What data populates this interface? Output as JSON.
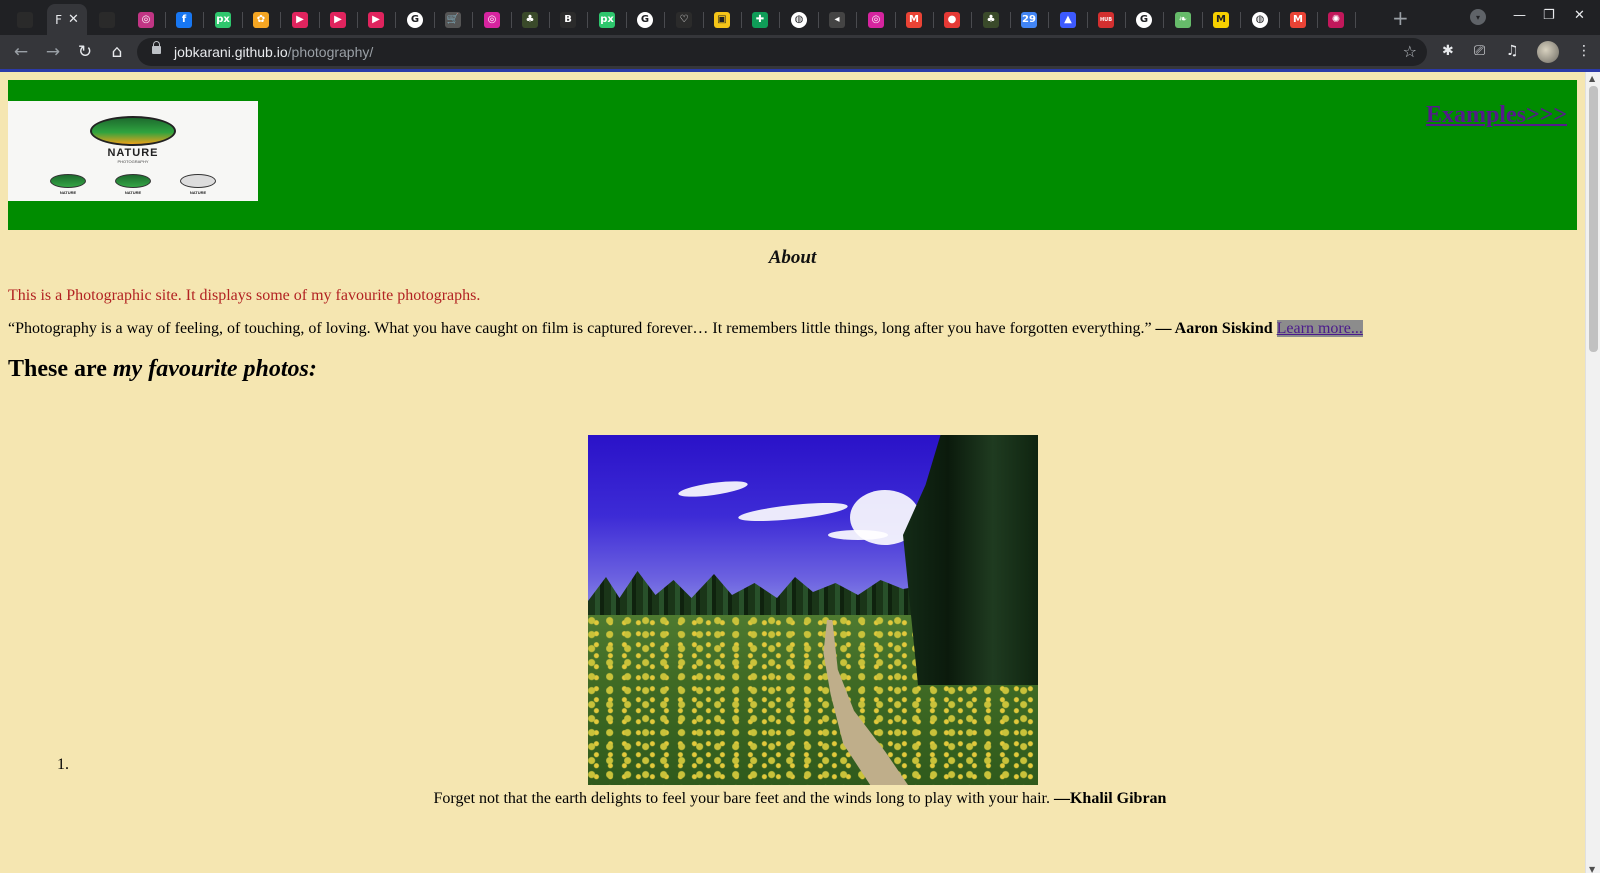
{
  "browser": {
    "active_tab_letter": "F",
    "active_tab_close": "✕",
    "new_tab": "+",
    "window_controls": {
      "minimize": "—",
      "restore": "❐",
      "close": "✕"
    },
    "nav": {
      "back": "←",
      "forward": "→",
      "reload": "↻",
      "home": "⌂"
    },
    "url_host": "jobkarani.github.io",
    "url_path": "/photography/",
    "bookmark_star": "☆",
    "toolbar_icons": {
      "extensions": "✱",
      "cast": "⎚",
      "media": "♫",
      "menu": "⋮"
    },
    "tab_favicons": [
      {
        "name": "instagram-icon",
        "color": "#c13584",
        "glyph": "◎"
      },
      {
        "name": "facebook-icon",
        "color": "#1877f2",
        "glyph": "f"
      },
      {
        "name": "pixabay-icon",
        "color": "#2ec66d",
        "glyph": "px"
      },
      {
        "name": "gear-icon",
        "color": "#f5a623",
        "glyph": "✿"
      },
      {
        "name": "youtube-icon",
        "color": "#e0245e",
        "glyph": "▶"
      },
      {
        "name": "youtube-icon",
        "color": "#e0245e",
        "glyph": "▶"
      },
      {
        "name": "youtube-icon",
        "color": "#e0245e",
        "glyph": "▶"
      },
      {
        "name": "google-icon",
        "color": "#ffffff",
        "glyph": "G"
      },
      {
        "name": "cart-icon",
        "color": "#555555",
        "glyph": "🛒"
      },
      {
        "name": "instagram-icon",
        "color": "#d6249f",
        "glyph": "◎"
      },
      {
        "name": "palm-icon",
        "color": "#3a4a2a",
        "glyph": "♣"
      },
      {
        "name": "bold-b-icon",
        "color": "#2b2b2b",
        "glyph": "B"
      },
      {
        "name": "pixabay-icon",
        "color": "#2ec66d",
        "glyph": "px"
      },
      {
        "name": "google-icon",
        "color": "#ffffff",
        "glyph": "G"
      },
      {
        "name": "heart-icon",
        "color": "#2b2b2b",
        "glyph": "♡"
      },
      {
        "name": "badge-icon",
        "color": "#f5c518",
        "glyph": "▣"
      },
      {
        "name": "sheets-icon",
        "color": "#0f9d58",
        "glyph": "✚"
      },
      {
        "name": "globe-icon",
        "color": "#ffffff",
        "glyph": "◍"
      },
      {
        "name": "speaker-icon",
        "color": "#444444",
        "glyph": "◂"
      },
      {
        "name": "instagram-icon",
        "color": "#d6249f",
        "glyph": "◎"
      },
      {
        "name": "gmail-icon",
        "color": "#ea4335",
        "glyph": "M"
      },
      {
        "name": "record-icon",
        "color": "#e53935",
        "glyph": "●"
      },
      {
        "name": "palm-icon",
        "color": "#3a4a2a",
        "glyph": "♣"
      },
      {
        "name": "calendar-icon",
        "color": "#4285f4",
        "glyph": "29"
      },
      {
        "name": "delta-icon",
        "color": "#3d5afe",
        "glyph": "▲"
      },
      {
        "name": "hub-icon",
        "color": "#d32f2f",
        "glyph": "HUB"
      },
      {
        "name": "google-icon",
        "color": "#ffffff",
        "glyph": "G"
      },
      {
        "name": "leaf-icon",
        "color": "#66bb6a",
        "glyph": "❧"
      },
      {
        "name": "m-badge-icon",
        "color": "#f7d000",
        "glyph": "M"
      },
      {
        "name": "globe-icon",
        "color": "#ffffff",
        "glyph": "◍"
      },
      {
        "name": "gmail-icon",
        "color": "#ea4335",
        "glyph": "M"
      },
      {
        "name": "settings-icon",
        "color": "#c2185b",
        "glyph": "✺"
      }
    ]
  },
  "page": {
    "banner_color": "#008c00",
    "background_color": "#f5e6b1",
    "logo_text": "NATURE",
    "logo_subtext": "PHOTOGRAPHY",
    "logo_mini_text": "NATURE",
    "examples_link": "Examples>>>",
    "about_heading": "About",
    "intro_text": "This is a Photographic site. It displays some of my favourite photographs.",
    "quote_text": "“Photography is a way of feeling, of touching, of loving. What you have caught on film is captured forever… It remembers little things, long after you have forgotten everything.”",
    "quote_author": "— Aaron Siskind",
    "learn_more": "Learn more...",
    "heading_plain": "These are ",
    "heading_italic": "my favourite photos:",
    "list_number": "1.",
    "caption_text": "Forget not that the earth delights to feel your bare feet and the winds long to play with your hair.",
    "caption_author": "—Khalil Gibran"
  }
}
